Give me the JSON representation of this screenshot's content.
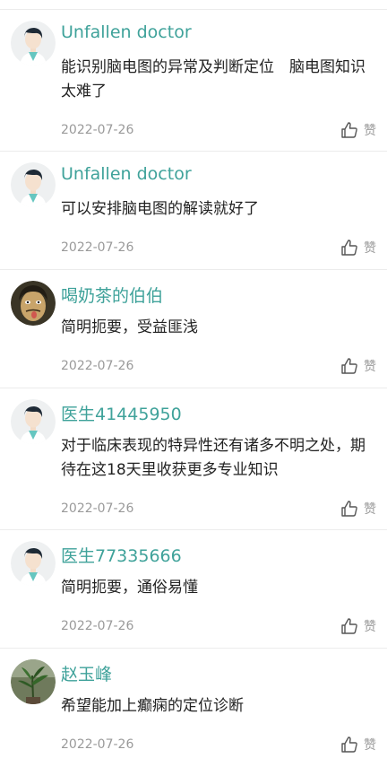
{
  "comments": [
    {
      "avatar": "doctor-avatar",
      "name": "Unfallen doctor",
      "text": "能识别脑电图的异常及判断定位　脑电图知识太难了",
      "date": "2022-07-26",
      "like_label": "赞"
    },
    {
      "avatar": "doctor-avatar",
      "name": "Unfallen doctor",
      "text": "可以安排脑电图的解读就好了",
      "date": "2022-07-26",
      "like_label": "赞"
    },
    {
      "avatar": "cartoon-face-avatar",
      "name": "喝奶茶的伯伯",
      "text": "简明扼要，受益匪浅",
      "date": "2022-07-26",
      "like_label": "赞"
    },
    {
      "avatar": "doctor-avatar",
      "name": "医生41445950",
      "text": "对于临床表现的特异性还有诸多不明之处，期待在这18天里收获更多专业知识",
      "date": "2022-07-26",
      "like_label": "赞"
    },
    {
      "avatar": "doctor-avatar",
      "name": "医生77335666",
      "text": "简明扼要，通俗易懂",
      "date": "2022-07-26",
      "like_label": "赞"
    },
    {
      "avatar": "plant-photo-avatar",
      "name": "赵玉峰",
      "text": "希望能加上癫痫的定位诊断",
      "date": "2022-07-26",
      "like_label": "赞"
    }
  ],
  "colors": {
    "name": "#3fa29a",
    "text": "#222222",
    "meta": "#9a9a9a",
    "divider": "#ececec"
  }
}
